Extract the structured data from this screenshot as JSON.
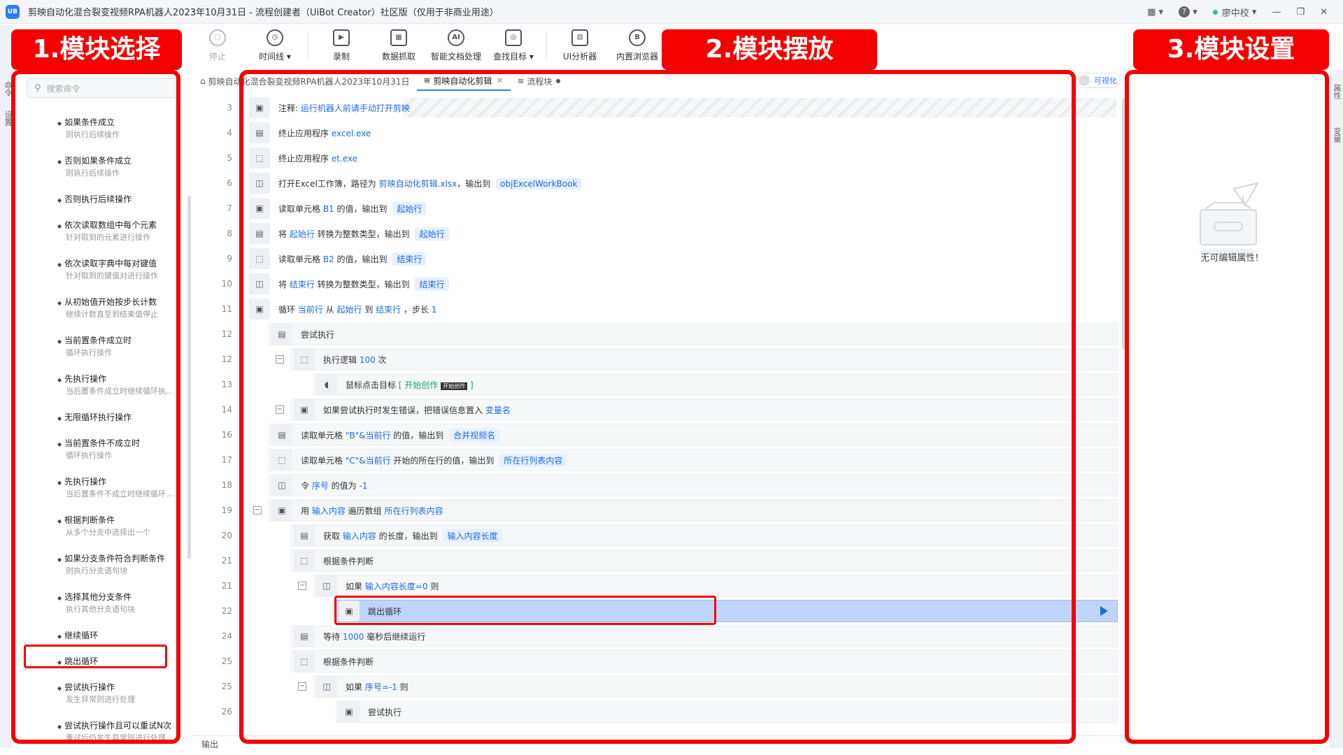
{
  "window": {
    "logo": "UB",
    "title": "剪映自动化混合裂变视频RPA机器人2023年10月31日 - 流程创建者（UiBot Creator）社区版（仅用于非商业用途）",
    "user": "廖中校",
    "help": "?",
    "colors": {
      "accent": "#2f7cf6",
      "annotation_red": "#f40000",
      "selected_row": "#bfd5fb"
    }
  },
  "toolbar": {
    "items": [
      {
        "label": "停止",
        "icon": "stop-icon",
        "glyph": "□",
        "disabled": true
      },
      {
        "label": "时间线 ▾",
        "icon": "clock-icon",
        "glyph": "◷"
      },
      {
        "label": "录制",
        "icon": "record-icon",
        "glyph": "▶"
      },
      {
        "label": "数据抓取",
        "icon": "data-scrape-icon",
        "glyph": "▦"
      },
      {
        "label": "智能文档处理",
        "icon": "ai-document-icon",
        "glyph": "AI"
      },
      {
        "label": "查找目标 ▾",
        "icon": "find-target-icon",
        "glyph": "◎"
      },
      {
        "label": "UI分析器",
        "icon": "ui-analyzer-icon",
        "glyph": "⊡"
      },
      {
        "label": "内置浏览器",
        "icon": "browser-icon",
        "glyph": "B"
      }
    ]
  },
  "callouts": {
    "select": "1.模块选择",
    "place": "2.模块摆放",
    "settings": "3.模块设置"
  },
  "left_panel": {
    "search_placeholder": "搜索命令",
    "commands": [
      {
        "title": "如果条件成立",
        "desc": "则执行后续操作"
      },
      {
        "title": "否则如果条件成立",
        "desc": "则执行后续操作"
      },
      {
        "title": "否则执行后续操作",
        "desc": ""
      },
      {
        "title": "依次读取数组中每个元素",
        "desc": "针对取到的元素进行操作"
      },
      {
        "title": "依次读取字典中每对键值",
        "desc": "针对取到的键值对进行操作"
      },
      {
        "title": "从初始值开始按步长计数",
        "desc": "继续计数直至到结束值停止"
      },
      {
        "title": "当前置条件成立时",
        "desc": "循环执行操作"
      },
      {
        "title": "先执行操作",
        "desc": "当后置条件成立时继续循环执..."
      },
      {
        "title": "无限循环执行操作",
        "desc": ""
      },
      {
        "title": "当前置条件不成立时",
        "desc": "循环执行操作"
      },
      {
        "title": "先执行操作",
        "desc": "当后置条件不成立时继续循环..."
      },
      {
        "title": "根据判断条件",
        "desc": "从多个分支中选择出一个"
      },
      {
        "title": "如果分支条件符合判断条件",
        "desc": "则执行分支语句块"
      },
      {
        "title": "选择其他分支条件",
        "desc": "执行其他分支语句块"
      },
      {
        "title": "继续循环",
        "desc": ""
      },
      {
        "title": "跳出循环",
        "desc": ""
      },
      {
        "title": "尝试执行操作",
        "desc": "发生异常则进行处理"
      },
      {
        "title": "尝试执行操作且可以重试N次",
        "desc": "重试后仍发生异常则进行处理"
      }
    ]
  },
  "tabs": [
    {
      "label": "剪映自动化混合裂变视频RPA机器人2023年10月31日",
      "icon": "project-icon"
    },
    {
      "label": "剪映自动化剪辑",
      "icon": "flow-icon",
      "active": true
    },
    {
      "label": "流程块",
      "icon": "flow-icon",
      "modified": true
    }
  ],
  "visual_toggle": "可视化",
  "editor": {
    "rows": [
      {
        "ln": "3",
        "indent": 0,
        "parts": [
          [
            "注释: ",
            ""
          ],
          [
            "运行机器人前请手动打开剪映",
            "hl"
          ]
        ],
        "comment": true
      },
      {
        "ln": "4",
        "indent": 0,
        "parts": [
          [
            "终止应用程序 ",
            ""
          ],
          [
            "excel.exe",
            "hl"
          ]
        ]
      },
      {
        "ln": "5",
        "indent": 0,
        "parts": [
          [
            "终止应用程序 ",
            ""
          ],
          [
            "et.exe",
            "hl"
          ]
        ]
      },
      {
        "ln": "6",
        "indent": 0,
        "parts": [
          [
            "打开Excel工作簿，路径为 ",
            ""
          ],
          [
            "剪映自动化剪辑.xlsx",
            "hl"
          ],
          [
            "，输出到 ",
            ""
          ],
          [
            "objExcelWorkBook",
            "pill"
          ]
        ]
      },
      {
        "ln": "7",
        "indent": 0,
        "parts": [
          [
            "读取单元格 ",
            ""
          ],
          [
            "B1",
            "hl"
          ],
          [
            " 的值，输出到 ",
            ""
          ],
          [
            "起始行",
            "pill"
          ]
        ]
      },
      {
        "ln": "8",
        "indent": 0,
        "parts": [
          [
            "将 ",
            ""
          ],
          [
            "起始行",
            "hl"
          ],
          [
            " 转换为整数类型，输出到 ",
            ""
          ],
          [
            "起始行",
            "pill"
          ]
        ]
      },
      {
        "ln": "9",
        "indent": 0,
        "parts": [
          [
            "读取单元格 ",
            ""
          ],
          [
            "B2",
            "hl"
          ],
          [
            " 的值，输出到 ",
            ""
          ],
          [
            "结束行",
            "pill"
          ]
        ]
      },
      {
        "ln": "10",
        "indent": 0,
        "parts": [
          [
            "将 ",
            ""
          ],
          [
            "结束行",
            "hl"
          ],
          [
            " 转换为整数类型，输出到 ",
            ""
          ],
          [
            "结束行",
            "pill"
          ]
        ]
      },
      {
        "ln": "11",
        "indent": 0,
        "parts": [
          [
            "循环 ",
            ""
          ],
          [
            "当前行",
            "hl"
          ],
          [
            " 从 ",
            ""
          ],
          [
            "起始行",
            "hl"
          ],
          [
            " 到 ",
            ""
          ],
          [
            "结束行",
            "hl"
          ],
          [
            " ，步长 ",
            ""
          ],
          [
            "1",
            "hl"
          ]
        ]
      },
      {
        "ln": "12",
        "indent": 1,
        "parts": [
          [
            "尝试执行",
            ""
          ]
        ]
      },
      {
        "ln": "12",
        "indent": 2,
        "toggle": true,
        "parts": [
          [
            "执行逻辑 ",
            ""
          ],
          [
            "100",
            "hl"
          ],
          [
            " 次",
            ""
          ]
        ]
      },
      {
        "ln": "13",
        "indent": 3,
        "parts": [
          [
            "鼠标点击目标 ",
            ""
          ],
          [
            "[ 开始创作 ",
            "green"
          ],
          [
            "开始创作",
            "tag"
          ],
          [
            " ]",
            "green"
          ]
        ],
        "mouse": true
      },
      {
        "ln": "14",
        "indent": 2,
        "toggle": true,
        "parts": [
          [
            "如果尝试执行时发生错误，把错误信息置入 ",
            ""
          ],
          [
            "变量名",
            "hl"
          ]
        ]
      },
      {
        "ln": "16",
        "indent": 1,
        "parts": [
          [
            "读取单元格 ",
            ""
          ],
          [
            "\"B\"&当前行",
            "hl"
          ],
          [
            " 的值，输出到 ",
            ""
          ],
          [
            "合并视频名",
            "pill"
          ]
        ]
      },
      {
        "ln": "17",
        "indent": 1,
        "parts": [
          [
            "读取单元格 ",
            ""
          ],
          [
            "\"C\"&当前行",
            "hl"
          ],
          [
            " 开始的所在行的值，输出到 ",
            ""
          ],
          [
            "所在行列表内容",
            "pill"
          ]
        ]
      },
      {
        "ln": "18",
        "indent": 1,
        "parts": [
          [
            "令 ",
            ""
          ],
          [
            "序号",
            "hl"
          ],
          [
            " 的值为 ",
            ""
          ],
          [
            "-1",
            "hl"
          ]
        ]
      },
      {
        "ln": "19",
        "indent": 1,
        "toggle": true,
        "parts": [
          [
            "用 ",
            ""
          ],
          [
            "输入内容",
            "hl"
          ],
          [
            " 遍历数组 ",
            ""
          ],
          [
            "所在行列表内容",
            "hl"
          ]
        ]
      },
      {
        "ln": "20",
        "indent": 2,
        "parts": [
          [
            "获取 ",
            ""
          ],
          [
            "输入内容",
            "hl"
          ],
          [
            " 的长度，输出到 ",
            ""
          ],
          [
            "输入内容长度",
            "pill"
          ]
        ]
      },
      {
        "ln": "21",
        "indent": 2,
        "parts": [
          [
            "根据条件判断",
            ""
          ]
        ]
      },
      {
        "ln": "21",
        "indent": 3,
        "toggle": true,
        "parts": [
          [
            "如果 ",
            ""
          ],
          [
            "输入内容长度=0",
            "hl"
          ],
          [
            " 则",
            ""
          ]
        ]
      },
      {
        "ln": "22",
        "indent": 4,
        "parts": [
          [
            "跳出循环",
            ""
          ]
        ],
        "selected": true
      },
      {
        "ln": "24",
        "indent": 2,
        "parts": [
          [
            "等待 ",
            ""
          ],
          [
            "1000",
            "hl"
          ],
          [
            " 毫秒后继续运行",
            ""
          ]
        ]
      },
      {
        "ln": "25",
        "indent": 2,
        "parts": [
          [
            "根据条件判断",
            ""
          ]
        ]
      },
      {
        "ln": "25",
        "indent": 3,
        "toggle": true,
        "parts": [
          [
            "如果 ",
            ""
          ],
          [
            "序号=-1",
            "hl"
          ],
          [
            " 则",
            ""
          ]
        ]
      },
      {
        "ln": "26",
        "indent": 4,
        "parts": [
          [
            "尝试执行",
            ""
          ]
        ]
      }
    ]
  },
  "right_panel": {
    "empty_text": "无可编辑属性!",
    "side_tab_1": "属性",
    "side_tab_2": "变量"
  },
  "left_side_tabs": [
    "命令",
    "设置"
  ],
  "bottom": {
    "output_label": "输出"
  }
}
